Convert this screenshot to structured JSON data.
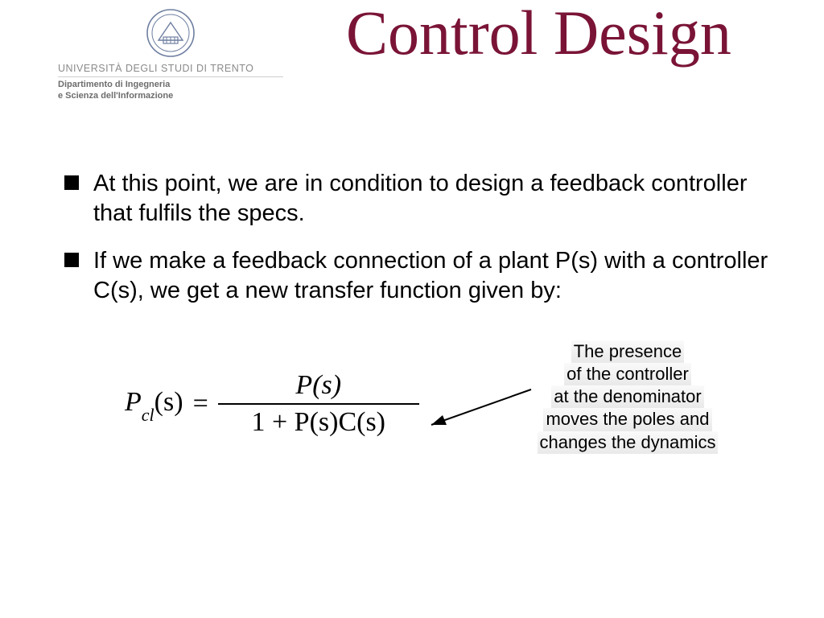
{
  "logo": {
    "university": "UNIVERSITÀ DEGLI STUDI DI TRENTO",
    "dept_line1": "Dipartimento di Ingegneria",
    "dept_line2": "e Scienza dell'Informazione"
  },
  "title": "Control Design",
  "bullets": [
    "At this point, we are in condition to design a feedback controller that fulfils the specs.",
    "If we make a feedback connection of a plant P(s) with a controller C(s), we get a new transfer function given by:"
  ],
  "formula": {
    "lhs_P": "P",
    "lhs_sub": "cl",
    "lhs_arg": "(s)",
    "eq": "=",
    "num": "P(s)",
    "den": "1 + P(s)C(s)"
  },
  "annotation": {
    "l1": "The presence",
    "l2": "of the controller",
    "l3": "at the denominator",
    "l4": "moves the poles and",
    "l5": "changes the dynamics"
  }
}
